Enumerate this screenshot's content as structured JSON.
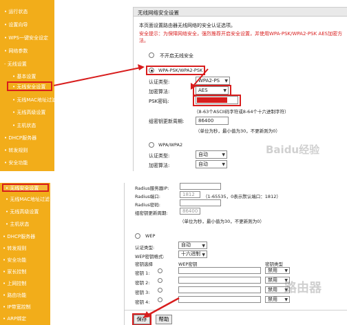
{
  "top": {
    "sidebar": {
      "items": [
        {
          "label": "• 运行状态",
          "sub": false
        },
        {
          "label": "• 设置向导",
          "sub": false
        },
        {
          "label": "• WPS一键安全设定",
          "sub": false
        },
        {
          "label": "• 网络参数",
          "sub": false
        },
        {
          "label": "- 无线设置",
          "sub": false
        },
        {
          "label": "• 基本设置",
          "sub": true
        },
        {
          "label": "• 无线安全设置",
          "sub": true
        },
        {
          "label": "• 无线MAC地址过滤",
          "sub": true
        },
        {
          "label": "• 无线高级设置",
          "sub": true
        },
        {
          "label": "• 主机状态",
          "sub": true
        },
        {
          "label": "• DHCP服务器",
          "sub": false
        },
        {
          "label": "• 转发规则",
          "sub": false
        },
        {
          "label": "• 安全功能",
          "sub": false
        }
      ]
    },
    "title": "无线网络安全设置",
    "intro": "本页面设置路由器无线网络的安全认证选项。",
    "warning": "安全提示：为保障网络安全，强烈推荐开启安全设置，并使用WPA-PSK/WPA2-PSK AES加密方法。",
    "no_security_label": "不开启无线安全",
    "wpa_psk_label": "WPA-PSK/WPA2-PSK",
    "auth_type_label": "认证类型:",
    "auth_type_value": "WPA2-PS",
    "cipher_label": "加密算法:",
    "cipher_value": "AES",
    "psk_label": "PSK密码:",
    "psk_hint": "（8-63个ASCII码字符或8-64个十六进制字符）",
    "renew_label": "组密钥更新周期:",
    "renew_value": "86400",
    "renew_hint": "（单位为秒，最小值为30，不更新则为0）",
    "wpa_label": "WPA/WPA2",
    "auth_type2_label": "认证类型:",
    "auth_type2_value": "自动",
    "cipher2_label": "加密算法:",
    "cipher2_value": "自动",
    "watermark": "Baidu经验"
  },
  "bottom": {
    "sidebar": {
      "items": [
        {
          "label": "• 无线安全设置",
          "sub": true
        },
        {
          "label": "• 无线MAC地址过滤",
          "sub": true
        },
        {
          "label": "• 无线高级设置",
          "sub": true
        },
        {
          "label": "• 主机状态",
          "sub": true
        },
        {
          "label": "• DHCP服务器",
          "sub": false
        },
        {
          "label": "• 转发规则",
          "sub": false
        },
        {
          "label": "• 安全功能",
          "sub": false
        },
        {
          "label": "• 家长控制",
          "sub": false
        },
        {
          "label": "• 上网控制",
          "sub": false
        },
        {
          "label": "• 路由功能",
          "sub": false
        },
        {
          "label": "• IP带宽控制",
          "sub": false
        },
        {
          "label": "• ARP绑定",
          "sub": false
        }
      ]
    },
    "radius_server_label": "Radius服务器IP:",
    "radius_port_label": "Radius端口:",
    "radius_port_value": "1812",
    "radius_port_hint": "（1-65535，0表示默认端口：1812）",
    "radius_pwd_label": "Radius密码:",
    "renew_label": "组密钥更新周期:",
    "renew_value": "86400",
    "renew_hint": "（单位为秒，最小值为30，不更新则为0）",
    "wep_label": "WEP",
    "auth_type_label": "认证类型:",
    "auth_type_value": "自动",
    "wep_format_label": "WEP密钥格式:",
    "wep_format_value": "十六进制",
    "key_select_label": "密钥选择",
    "wep_key_label": "WEP密钥",
    "key_type_label": "密钥类型",
    "keys": [
      {
        "label": "密钥 1:",
        "type": "禁用"
      },
      {
        "label": "密钥 2:",
        "type": "禁用"
      },
      {
        "label": "密钥 3:",
        "type": "禁用"
      },
      {
        "label": "密钥 4:",
        "type": "禁用"
      }
    ],
    "save_label": "保存",
    "help_label": "帮助",
    "watermark": "路由器"
  },
  "colors": {
    "sidebar": "#f2ad1a",
    "highlight": "#d81d1d",
    "arrow": "#d81d1d"
  }
}
